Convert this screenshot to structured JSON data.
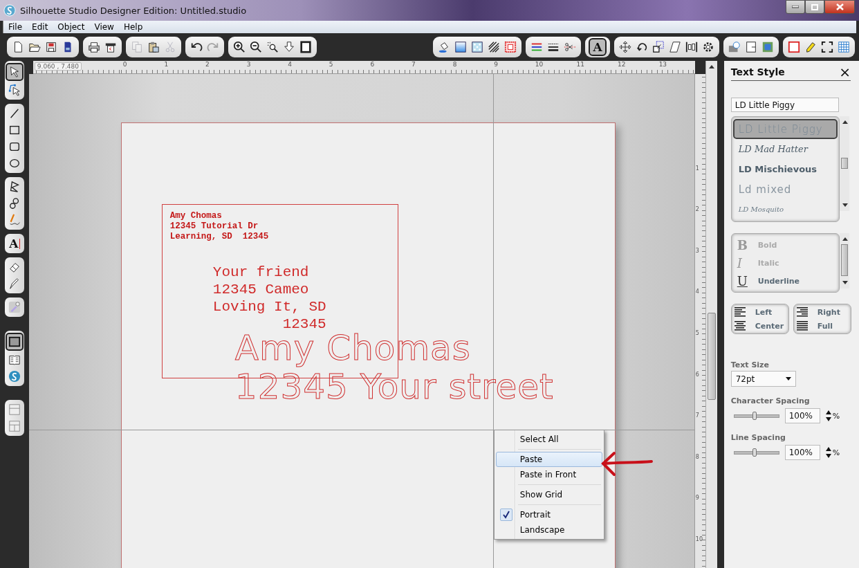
{
  "window": {
    "title": "Silhouette Studio Designer Edition: Untitled.studio"
  },
  "menu": [
    "File",
    "Edit",
    "Object",
    "View",
    "Help"
  ],
  "toolbar": {
    "left": [
      [
        {
          "kind": "page",
          "selected": false,
          "disabled": false
        },
        {
          "kind": "folder",
          "selected": false,
          "disabled": false
        },
        {
          "kind": "floppy-disk",
          "selected": false,
          "disabled": false
        },
        {
          "kind": "memory-card",
          "selected": false,
          "disabled": false
        }
      ],
      [
        {
          "kind": "printer",
          "selected": false,
          "disabled": false
        },
        {
          "kind": "cutter",
          "selected": false,
          "disabled": false
        }
      ],
      [
        {
          "kind": "copy",
          "selected": false,
          "disabled": true
        },
        {
          "kind": "clipboard",
          "selected": false,
          "disabled": false
        },
        {
          "kind": "scissors",
          "selected": false,
          "disabled": true
        }
      ],
      [
        {
          "kind": "undo",
          "selected": false,
          "disabled": false
        },
        {
          "kind": "redo",
          "selected": false,
          "disabled": true
        }
      ],
      [
        {
          "kind": "zoom-in",
          "selected": false,
          "disabled": false
        },
        {
          "kind": "zoom-out",
          "selected": false,
          "disabled": false
        },
        {
          "kind": "zoom-select",
          "selected": false,
          "disabled": false
        },
        {
          "kind": "down-arrow",
          "selected": false,
          "disabled": false
        },
        {
          "kind": "frame",
          "selected": false,
          "disabled": false
        }
      ]
    ],
    "right": [
      [
        {
          "kind": "paint-bucket",
          "selected": false,
          "disabled": false
        },
        {
          "kind": "gradient",
          "selected": false,
          "disabled": false
        },
        {
          "kind": "pattern",
          "selected": false,
          "disabled": false
        },
        {
          "kind": "hatch",
          "selected": false,
          "disabled": false
        },
        {
          "kind": "dotted-square",
          "selected": false,
          "disabled": false
        }
      ],
      [
        {
          "kind": "color-lines",
          "selected": false,
          "disabled": false
        },
        {
          "kind": "dashed-lines",
          "selected": false,
          "disabled": false
        },
        {
          "kind": "cut-line",
          "selected": false,
          "disabled": false
        }
      ],
      [
        {
          "kind": "letter",
          "glyph": "A",
          "selected": true,
          "disabled": false
        }
      ],
      [
        {
          "kind": "move-arrows",
          "selected": false,
          "disabled": false
        },
        {
          "kind": "rotate",
          "selected": false,
          "disabled": false
        },
        {
          "kind": "scale",
          "selected": false,
          "disabled": false
        },
        {
          "kind": "parallelogram",
          "selected": false,
          "disabled": false
        },
        {
          "kind": "align-bars",
          "selected": false,
          "disabled": false
        },
        {
          "kind": "gear",
          "selected": false,
          "disabled": false
        }
      ],
      [
        {
          "kind": "library",
          "selected": false,
          "disabled": false
        },
        {
          "kind": "page-corner",
          "selected": false,
          "disabled": false
        },
        {
          "kind": "filled-square",
          "selected": false,
          "disabled": false
        }
      ],
      [
        {
          "kind": "outline-square",
          "selected": false,
          "disabled": false
        },
        {
          "kind": "pencil",
          "selected": false,
          "disabled": false
        },
        {
          "kind": "corners",
          "selected": false,
          "disabled": false
        },
        {
          "kind": "grid",
          "selected": false,
          "disabled": false
        }
      ]
    ]
  },
  "tools": [
    [
      {
        "kind": "pointer",
        "selected": true
      },
      {
        "kind": "node-pointer",
        "selected": false
      }
    ],
    [
      {
        "kind": "line",
        "selected": false
      },
      {
        "kind": "rectangle",
        "selected": false
      },
      {
        "kind": "rounded-rectangle",
        "selected": false
      },
      {
        "kind": "ellipse",
        "selected": false
      }
    ],
    [
      {
        "kind": "polygon",
        "selected": false
      },
      {
        "kind": "curve",
        "selected": false
      },
      {
        "kind": "freehand",
        "selected": false
      }
    ],
    [
      {
        "kind": "letter",
        "glyph": "A",
        "selected": false
      }
    ],
    [
      {
        "kind": "eraser",
        "selected": false
      },
      {
        "kind": "knife",
        "selected": false
      }
    ],
    [
      {
        "kind": "eyedropper",
        "selected": false
      }
    ],
    [
      {
        "kind": "window",
        "selected": true
      },
      {
        "kind": "book",
        "selected": false
      },
      {
        "kind": "swirl-circle",
        "selected": false
      }
    ],
    [
      {
        "kind": "panel-top",
        "selected": false
      },
      {
        "kind": "panel-split",
        "selected": false
      }
    ]
  ],
  "ruler": {
    "coordinates": "9.060 , 7.480",
    "labels": [
      "0",
      "1",
      "2",
      "3",
      "4",
      "5",
      "6",
      "7",
      "8",
      "9",
      "10",
      "11",
      "12",
      "13"
    ],
    "vertical_labels": [
      "1",
      "2",
      "3",
      "4",
      "5",
      "6",
      "7",
      "8",
      "9",
      "10"
    ]
  },
  "canvas": {
    "return_address": [
      "Amy Chomas",
      "12345 Tutorial Dr",
      "Learning, SD  12345"
    ],
    "recipient": [
      {
        "text": "Your friend",
        "kind": "line"
      },
      {
        "text": "12345 Cameo",
        "kind": "line"
      },
      {
        "text": "Loving It, SD",
        "kind": "line"
      },
      {
        "text": "12345",
        "kind": "right"
      }
    ],
    "outlined_text": [
      "Amy Chomas",
      "12345 Your street"
    ]
  },
  "context_menu": [
    [
      {
        "label": "Select All",
        "selected": false,
        "checked": false
      }
    ],
    [
      {
        "label": "Paste",
        "selected": true,
        "checked": false
      },
      {
        "label": "Paste in Front",
        "selected": false,
        "checked": false
      }
    ],
    [
      {
        "label": "Show Grid",
        "selected": false,
        "checked": false
      }
    ],
    [
      {
        "label": "Portrait",
        "selected": false,
        "checked": true
      },
      {
        "label": "Landscape",
        "selected": false,
        "checked": false
      }
    ]
  ],
  "panel": {
    "title": "Text Style",
    "close": "×",
    "font_field": "LD Little Piggy",
    "fonts": [
      {
        "label": "LD Little Piggy",
        "selected": true
      },
      {
        "label": "LD Mad Hatter",
        "selected": false
      },
      {
        "label": "LD Mischievous",
        "selected": false
      },
      {
        "label": "Ld mixed",
        "selected": false
      },
      {
        "label": "LD Mosquito",
        "selected": false
      }
    ],
    "styles": [
      {
        "glyph": "B",
        "label": "Bold",
        "disabled": true
      },
      {
        "glyph": "I",
        "label": "Italic",
        "disabled": true
      },
      {
        "glyph": "U",
        "label": "Underline",
        "disabled": false
      }
    ],
    "alignment": [
      [
        {
          "kind": "left",
          "label": "Left"
        },
        {
          "kind": "center",
          "label": "Center"
        }
      ],
      [
        {
          "kind": "right",
          "label": "Right"
        },
        {
          "kind": "full",
          "label": "Full"
        }
      ]
    ],
    "text_size": {
      "label": "Text Size",
      "value": "72pt"
    },
    "character_spacing": {
      "label": "Character Spacing",
      "level": 0.45,
      "value": "100%",
      "unit": "%"
    },
    "line_spacing": {
      "label": "Line Spacing",
      "level": 0.45,
      "value": "100%",
      "unit": "%"
    }
  }
}
